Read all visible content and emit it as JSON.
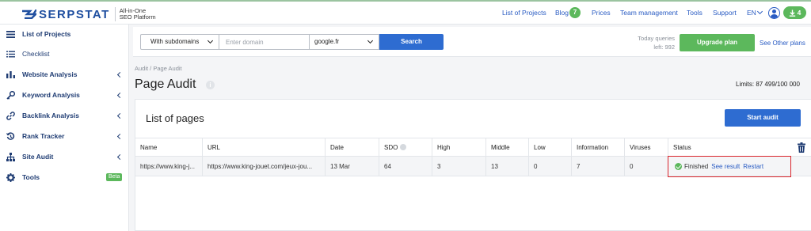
{
  "brand": {
    "name": "SERPSTAT",
    "tagline_line1": "All-in-One",
    "tagline_line2": "SEO Platform"
  },
  "topnav": {
    "items": [
      "List of Projects",
      "Blog",
      "Prices",
      "Team management",
      "Tools",
      "Support"
    ],
    "blog_badge": "7",
    "language": "EN",
    "downloads_count": "4"
  },
  "sidebar": {
    "items": [
      {
        "label": "List of Projects",
        "icon": "menu-icon",
        "expandable": false
      },
      {
        "label": "Checklist",
        "icon": "list-icon",
        "expandable": false
      },
      {
        "label": "Website Analysis",
        "icon": "analytics-icon",
        "expandable": true
      },
      {
        "label": "Keyword Analysis",
        "icon": "key-icon",
        "expandable": true
      },
      {
        "label": "Backlink Analysis",
        "icon": "link-icon",
        "expandable": true
      },
      {
        "label": "Rank Tracker",
        "icon": "history-icon",
        "expandable": true
      },
      {
        "label": "Site Audit",
        "icon": "sitemap-icon",
        "expandable": true
      },
      {
        "label": "Tools",
        "icon": "gear-icon",
        "expandable": false,
        "badge": "Beta"
      }
    ]
  },
  "search": {
    "subdomain_option": "With subdomains",
    "domain_placeholder": "Enter domain",
    "database": "google.fr",
    "button": "Search",
    "queries_line1": "Today queries",
    "queries_line2": "left: 992",
    "upgrade_button": "Upgrade plan",
    "other_plans": "See Other plans"
  },
  "page": {
    "breadcrumb": "Audit / Page Audit",
    "title": "Page Audit",
    "info_icon": "i",
    "limits": "Limits: 87 499/100 000"
  },
  "panel": {
    "title": "List of pages",
    "start_button": "Start audit",
    "columns": [
      "Name",
      "URL",
      "Date",
      "SDO",
      "High",
      "Middle",
      "Low",
      "Information",
      "Viruses",
      "Status"
    ],
    "rows": [
      {
        "name": "https://www.king-j...",
        "url": "https://www.king-jouet.com/jeux-jou...",
        "date": "13 Mar",
        "sdo": "64",
        "high": "3",
        "middle": "13",
        "low": "0",
        "information": "7",
        "viruses": "0",
        "status": "Finished",
        "see_result": "See result",
        "restart": "Restart"
      }
    ]
  },
  "colors": {
    "brand_blue": "#1f4fa0",
    "link": "#2a5cc3",
    "primary_button": "#2e6cd1",
    "green": "#5cb85c",
    "highlight_red": "#d9252c"
  }
}
